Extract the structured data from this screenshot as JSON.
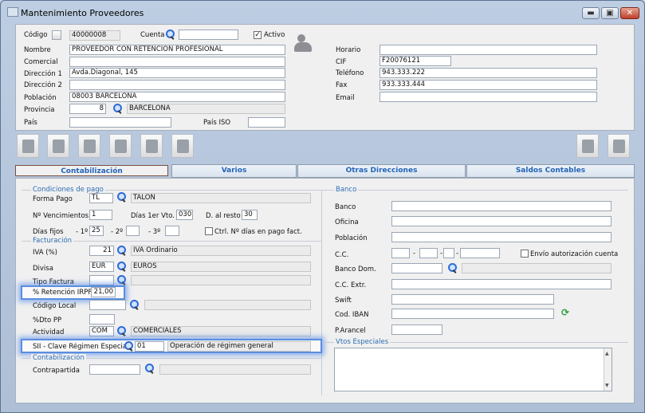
{
  "window": {
    "title": "Mantenimiento Proveedores",
    "minimize_glyph": "▬",
    "maximize_glyph": "▣",
    "close_glyph": "✕"
  },
  "header": {
    "codigo_label": "Código",
    "codigo_value": "40000008",
    "cuenta_label": "Cuenta",
    "cuenta_value": "",
    "activo_label": "Activo",
    "activo_checked": "✓",
    "nombre_label": "Nombre",
    "nombre_value": "PROVEEDOR CON RETENCIÓN PROFESIONAL",
    "comercial_label": "Comercial",
    "comercial_value": "",
    "direccion1_label": "Dirección 1",
    "direccion1_value": "Avda.Diagonal, 145",
    "direccion2_label": "Dirección 2",
    "direccion2_value": "",
    "poblacion_label": "Población",
    "poblacion_value": "08003 BARCELONA",
    "provincia_label": "Provincia",
    "provincia_code": "8",
    "provincia_name": "BARCELONA",
    "pais_label": "País",
    "pais_value": "",
    "pais_iso_label": "País ISO",
    "pais_iso_value": "",
    "horario_label": "Horario",
    "horario_value": "",
    "cif_label": "CIF",
    "cif_value": "F20076121",
    "telefono_label": "Teléfono",
    "telefono_value": "943.333.222",
    "fax_label": "Fax",
    "fax_value": "933.333.444",
    "email_label": "Email",
    "email_value": ""
  },
  "tabs": [
    {
      "label": "Contabilización"
    },
    {
      "label": "Varios"
    },
    {
      "label": "Otras Direcciones"
    },
    {
      "label": "Saldos Contables"
    }
  ],
  "condiciones": {
    "section_title": "Condiciones de pago",
    "forma_pago_label": "Forma Pago",
    "forma_pago_code": "TL",
    "forma_pago_name": "TALON",
    "n_vencimientos_label": "Nº Vencimientos",
    "n_vencimientos_value": "1",
    "dias_1er_vto_label": "Días 1er Vto.",
    "dias_1er_vto_value": "030",
    "d_al_resto_label": "D. al resto",
    "d_al_resto_value": "30",
    "dias_fijos_label": "Días fijos",
    "sep1": "- 1º",
    "dia1_value": "25",
    "sep2": "- 2º",
    "dia2_value": "",
    "sep3": "- 3º",
    "dia3_value": "",
    "ctrl_label": "Ctrl. Nº días en pago fact."
  },
  "facturacion": {
    "section_title": "Facturación",
    "iva_label": "IVA (%)",
    "iva_code": "21",
    "iva_name": "IVA Ordinario",
    "divisa_label": "Divisa",
    "divisa_code": "EUR",
    "divisa_name": "EUROS",
    "tipo_factura_label": "Tipo Factura",
    "retencion_label": "% Retención IRPF",
    "retencion_value": "21,00",
    "codigo_local_label": "Código Local",
    "dto_pp_label": "%Dto PP",
    "actividad_label": "Actividad",
    "actividad_code": "COM",
    "actividad_name": "COMERCIALES",
    "sii_label": "SII - Clave Régimen Especial",
    "sii_code": "01",
    "sii_name": "Operación de régimen general"
  },
  "contabilizacion": {
    "section_title": "Contabilización",
    "contrapartida_label": "Contrapartida"
  },
  "banco": {
    "section_title": "Banco",
    "banco_label": "Banco",
    "oficina_label": "Oficina",
    "poblacion_label": "Población",
    "cc_label": "C.C.",
    "cc_sep": "-",
    "envio_label": "Envío autorización cuenta",
    "banco_dom_label": "Banco Dom.",
    "cc_extr_label": "C.C. Extr.",
    "swift_label": "Swift",
    "iban_label": "Cod. IBAN",
    "p_arancel_label": "P.Arancel",
    "vtos_title": "Vtos Especiales"
  },
  "icons": {
    "scroll_up": "▲",
    "scroll_down": "▼",
    "refresh": "⟳"
  }
}
